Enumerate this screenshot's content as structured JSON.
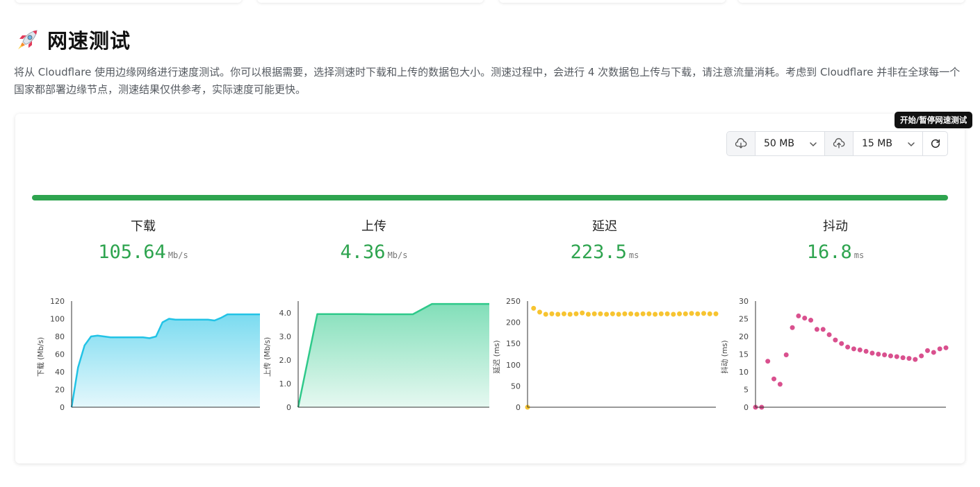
{
  "header": {
    "title": "网速测试",
    "description": "将从 Cloudflare 使用边缘网络进行速度测试。你可以根据需要，选择测速时下载和上传的数据包大小。测速过程中，会进行 4 次数据包上传与下载，请注意流量消耗。考虑到 Cloudflare 并非在全球每一个国家都部署边缘节点，测速结果仅供参考，实际速度可能更快。"
  },
  "toolbar": {
    "tooltip": "开始/暂停网速测试",
    "download_size": "50 MB",
    "upload_size": "15 MB",
    "download_icon": "cloud-download-icon",
    "upload_icon": "cloud-upload-icon",
    "refresh_icon": "refresh-icon"
  },
  "progress": {
    "value": 1.0,
    "color": "#2ea44f"
  },
  "metrics": [
    {
      "label": "下载",
      "value": "105.64",
      "unit": "Mb/s"
    },
    {
      "label": "上传",
      "value": "4.36",
      "unit": "Mb/s"
    },
    {
      "label": "延迟",
      "value": "223.5",
      "unit": "ms"
    },
    {
      "label": "抖动",
      "value": "16.8",
      "unit": "ms"
    }
  ],
  "colors": {
    "accent_green": "#2ea44f",
    "download": "#22c3e6",
    "upload": "#2ec98a",
    "latency": "#f7c430",
    "jitter": "#d9508e"
  },
  "chart_data": [
    {
      "type": "area",
      "ylabel": "下载 (Mb/s)",
      "ylim": [
        0,
        120
      ],
      "yticks": [
        "0",
        "20",
        "40",
        "60",
        "80",
        "100",
        "120"
      ],
      "x": [
        0,
        1,
        2,
        3,
        4,
        5,
        6,
        7,
        8,
        9,
        10,
        11,
        12,
        13,
        14,
        15,
        16,
        17,
        18,
        19,
        20,
        21,
        22,
        23,
        24,
        25,
        26,
        27,
        28,
        29
      ],
      "values": [
        0,
        45,
        70,
        80,
        81,
        80,
        79,
        79,
        79,
        79,
        79,
        79,
        78,
        80,
        96,
        100,
        99,
        99,
        99,
        99,
        99,
        99,
        98,
        101,
        105,
        105,
        105,
        105,
        105,
        105
      ]
    },
    {
      "type": "area",
      "ylabel": "上传 (Mb/s)",
      "ylim": [
        0,
        4.5
      ],
      "yticks": [
        "0",
        "1.0",
        "2.0",
        "3.0",
        "4.0"
      ],
      "x": [
        0,
        1,
        2,
        3,
        4,
        5,
        6,
        7,
        8,
        9,
        10
      ],
      "values": [
        0,
        3.95,
        3.95,
        3.95,
        3.94,
        3.94,
        3.94,
        4.38,
        4.38,
        4.38,
        4.38
      ]
    },
    {
      "type": "scatter",
      "ylabel": "延迟 (ms)",
      "ylim": [
        0,
        250
      ],
      "yticks": [
        "0",
        "50",
        "100",
        "150",
        "200",
        "250"
      ],
      "x": [
        0,
        1,
        2,
        3,
        4,
        5,
        6,
        7,
        8,
        9,
        10,
        11,
        12,
        13,
        14,
        15,
        16,
        17,
        18,
        19,
        20,
        21,
        22,
        23,
        24,
        25,
        26,
        27,
        28,
        29,
        30,
        31
      ],
      "values": [
        0,
        233,
        224,
        219,
        220,
        219,
        220,
        219,
        220,
        222,
        219,
        220,
        220,
        219,
        220,
        219,
        220,
        220,
        219,
        220,
        220,
        219,
        220,
        220,
        219,
        220,
        220,
        221,
        220,
        221,
        220,
        220
      ]
    },
    {
      "type": "scatter",
      "ylabel": "抖动 (ms)",
      "ylim": [
        0,
        30
      ],
      "yticks": [
        "0",
        "5",
        "10",
        "15",
        "20",
        "25",
        "30"
      ],
      "x": [
        0,
        1,
        2,
        3,
        4,
        5,
        6,
        7,
        8,
        9,
        10,
        11,
        12,
        13,
        14,
        15,
        16,
        17,
        18,
        19,
        20,
        21,
        22,
        23,
        24,
        25,
        26,
        27,
        28,
        29,
        30,
        31
      ],
      "values": [
        0,
        0,
        13,
        8,
        6.5,
        14.8,
        22.5,
        25.8,
        25.2,
        24.6,
        22,
        22,
        20.5,
        19,
        18,
        17,
        16.5,
        16.2,
        15.8,
        15.3,
        15,
        14.8,
        14.5,
        14.3,
        14,
        13.8,
        13.5,
        14.5,
        16,
        15.5,
        16.5,
        16.8
      ]
    }
  ]
}
